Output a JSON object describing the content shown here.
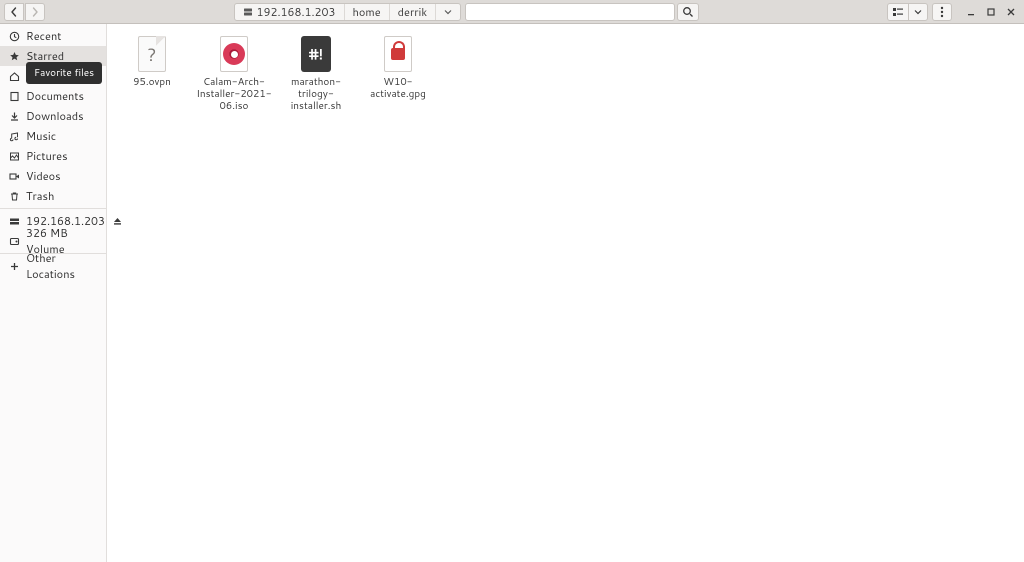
{
  "header": {
    "location_ip": "192.168.1.203",
    "crumbs": [
      "home",
      "derrik"
    ]
  },
  "tooltip": "Favorite files",
  "sidebar": {
    "items": [
      {
        "key": "recent",
        "label": "Recent",
        "icon": "clock"
      },
      {
        "key": "starred",
        "label": "Starred",
        "icon": "star",
        "selected": true,
        "tooltip": true
      },
      {
        "key": "home",
        "label": "",
        "icon": "home"
      },
      {
        "key": "documents",
        "label": "Documents",
        "icon": "doc"
      },
      {
        "key": "downloads",
        "label": "Downloads",
        "icon": "download"
      },
      {
        "key": "music",
        "label": "Music",
        "icon": "music"
      },
      {
        "key": "pictures",
        "label": "Pictures",
        "icon": "picture"
      },
      {
        "key": "videos",
        "label": "Videos",
        "icon": "video"
      },
      {
        "key": "trash",
        "label": "Trash",
        "icon": "trash"
      }
    ],
    "mounts": [
      {
        "key": "remote",
        "label": "192.168.1.203",
        "icon": "net",
        "eject": true
      },
      {
        "key": "volume",
        "label": "326 MB Volume",
        "icon": "disk"
      }
    ],
    "other": {
      "label": "Other Locations",
      "icon": "plus"
    }
  },
  "files": [
    {
      "name": "95.ovpn",
      "icon": "unknown"
    },
    {
      "name": "Calam-Arch-Installer-2021-06.iso",
      "icon": "iso"
    },
    {
      "name": "marathon-trilogy-installer.sh",
      "icon": "script"
    },
    {
      "name": "W10-activate.gpg",
      "icon": "gpg"
    }
  ]
}
